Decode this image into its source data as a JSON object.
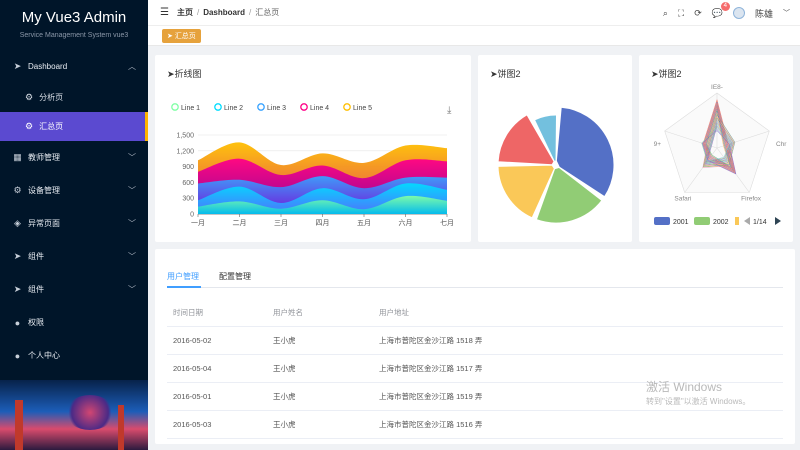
{
  "app": {
    "title": "My Vue3 Admin",
    "subtitle": "Service Management System vue3"
  },
  "sidebar": {
    "items": [
      {
        "label": "Dashboard",
        "icon": "send-icon",
        "arrow": "up"
      },
      {
        "label": "分析页",
        "icon": "gear-icon",
        "sub": true
      },
      {
        "label": "汇总页",
        "icon": "gear-icon",
        "sub": true,
        "active": true
      },
      {
        "label": "教师管理",
        "icon": "grid-icon",
        "arrow": "down"
      },
      {
        "label": "设备管理",
        "icon": "gear-icon",
        "arrow": "down"
      },
      {
        "label": "异常页面",
        "icon": "layers-icon",
        "arrow": "down"
      },
      {
        "label": "组件",
        "icon": "send-icon",
        "arrow": "down"
      },
      {
        "label": "组件",
        "icon": "send-icon",
        "arrow": "down"
      },
      {
        "label": "权限",
        "icon": "user-icon"
      },
      {
        "label": "个人中心",
        "icon": "user-icon"
      }
    ]
  },
  "topbar": {
    "breadcrumb": [
      "主页",
      "Dashboard",
      "汇总页"
    ],
    "notification_count": "4",
    "username": "陈雄"
  },
  "tags": {
    "active": "汇总页"
  },
  "cards": {
    "line": {
      "title": "折线图"
    },
    "pie": {
      "title": "饼图2"
    },
    "radar": {
      "title": "饼图2"
    }
  },
  "chart_data": [
    {
      "type": "area",
      "categories": [
        "一月",
        "二月",
        "三月",
        "四月",
        "五月",
        "六月",
        "七月"
      ],
      "ylim": [
        0,
        1500
      ],
      "yticks": [
        "1,500",
        "1,200",
        "900",
        "600",
        "300",
        "0"
      ],
      "series": [
        {
          "name": "Line 1",
          "values": [
            140,
            240,
            100,
            260,
            90,
            340,
            250
          ],
          "color": "#80ffa5"
        },
        {
          "name": "Line 2",
          "values": [
            120,
            280,
            110,
            230,
            190,
            240,
            210
          ],
          "color": "#00ddff"
        },
        {
          "name": "Line 3",
          "values": [
            320,
            130,
            300,
            230,
            210,
            110,
            230
          ],
          "color": "#37a2ff"
        },
        {
          "name": "Line 4",
          "values": [
            220,
            400,
            230,
            200,
            190,
            330,
            310
          ],
          "color": "#ff0087"
        },
        {
          "name": "Line 5",
          "values": [
            220,
            310,
            190,
            230,
            290,
            280,
            250
          ],
          "color": "#ffbf00"
        }
      ]
    },
    {
      "type": "pie",
      "values": [
        32,
        20,
        18,
        16,
        8
      ],
      "colors": [
        "#5470c6",
        "#91cc75",
        "#fac858",
        "#ee6666",
        "#73c0de"
      ]
    },
    {
      "type": "radar",
      "indicators": [
        "IE8-",
        "Chr",
        "Firefox",
        "Safari",
        "9+"
      ],
      "legend": [
        "2001",
        "2002"
      ],
      "legend_colors": [
        "#5470c6",
        "#91cc75",
        "#fac858"
      ],
      "pager": "1/14"
    }
  ],
  "table": {
    "tabs": [
      "用户管理",
      "配置管理"
    ],
    "headers": [
      "时间日期",
      "用户姓名",
      "用户地址"
    ],
    "rows": [
      [
        "2016-05-02",
        "王小虎",
        "上海市普陀区金沙江路 1518 弄"
      ],
      [
        "2016-05-04",
        "王小虎",
        "上海市普陀区金沙江路 1517 弄"
      ],
      [
        "2016-05-01",
        "王小虎",
        "上海市普陀区金沙江路 1519 弄"
      ],
      [
        "2016-05-03",
        "王小虎",
        "上海市普陀区金沙江路 1516 弄"
      ]
    ]
  },
  "watermark": {
    "line1": "激活 Windows",
    "line2": "转到\"设置\"以激活 Windows。"
  }
}
